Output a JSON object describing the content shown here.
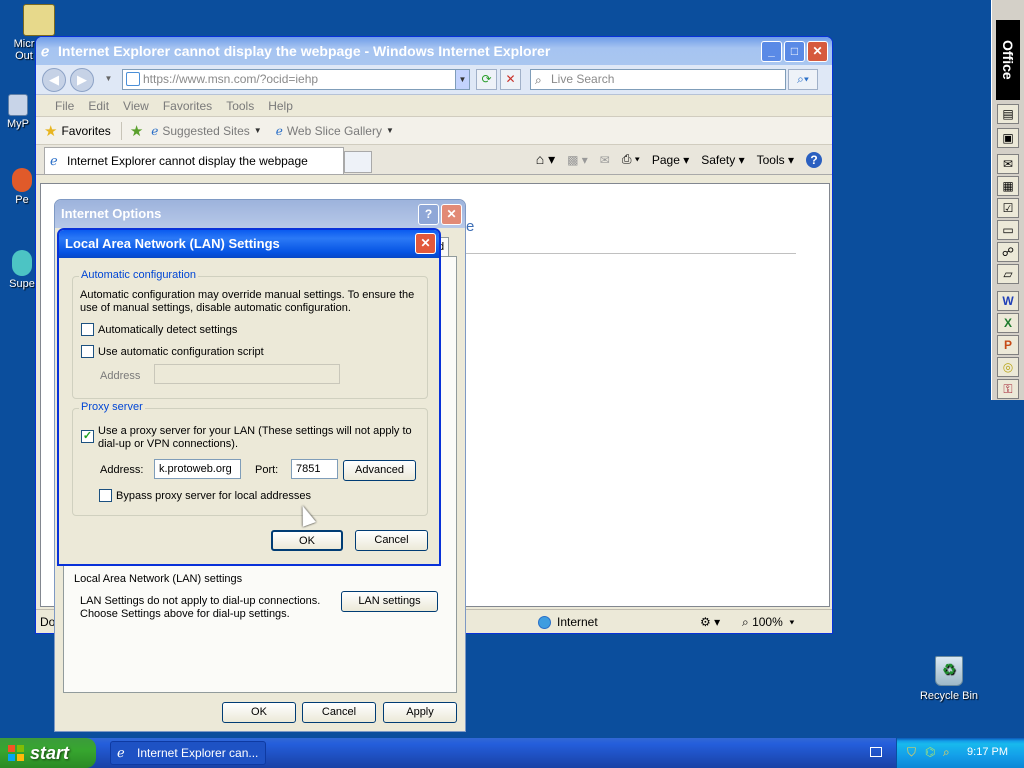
{
  "desktop": {
    "icons": [
      {
        "label": "Micr Out"
      },
      {
        "label": "MyP"
      },
      {
        "label": "Pe"
      },
      {
        "label": "Supe"
      }
    ],
    "recycle_bin": "Recycle Bin"
  },
  "office_bar": {
    "title": "Office"
  },
  "ie": {
    "title": "Internet Explorer cannot display the webpage - Windows Internet Explorer",
    "url": "https://www.msn.com/?ocid=iehp",
    "search_placeholder": "Live Search",
    "menu": [
      "File",
      "Edit",
      "View",
      "Favorites",
      "Tools",
      "Help"
    ],
    "favorites_label": "Favorites",
    "suggested_sites": "Suggested Sites",
    "web_slice_gallery": "Web Slice Gallery",
    "tab_label": "Internet Explorer cannot display the webpage",
    "cmd": {
      "page": "Page",
      "safety": "Safety",
      "tools": "Tools"
    },
    "content_fragment": "e",
    "status_done": "Don",
    "status_zone": "Internet",
    "zoom": "100%"
  },
  "internet_options": {
    "title": "Internet Options",
    "tab_fragment": "d",
    "lan_group_label": "Local Area Network (LAN) settings",
    "lan_text": "LAN Settings do not apply to dial-up connections. Choose Settings above for dial-up settings.",
    "lan_button": "LAN settings",
    "ok": "OK",
    "cancel": "Cancel",
    "apply": "Apply"
  },
  "lan_settings": {
    "title": "Local Area Network (LAN) Settings",
    "auto_config": {
      "legend": "Automatic configuration",
      "description": "Automatic configuration may override manual settings.  To ensure the use of manual settings, disable automatic configuration.",
      "auto_detect_label": "Automatically detect settings",
      "auto_detect_checked": false,
      "use_script_label": "Use automatic configuration script",
      "use_script_checked": false,
      "address_label": "Address",
      "address_value": ""
    },
    "proxy": {
      "legend": "Proxy server",
      "use_proxy_label": "Use a proxy server for your LAN (These settings will not apply to dial-up or VPN connections).",
      "use_proxy_checked": true,
      "address_label": "Address:",
      "address_value": "k.protoweb.org",
      "port_label": "Port:",
      "port_value": "7851",
      "advanced_button": "Advanced",
      "bypass_label": "Bypass proxy server for local addresses",
      "bypass_checked": false
    },
    "ok": "OK",
    "cancel": "Cancel"
  },
  "taskbar": {
    "start": "start",
    "task_button": "Internet Explorer can...",
    "clock": "9:17 PM"
  }
}
